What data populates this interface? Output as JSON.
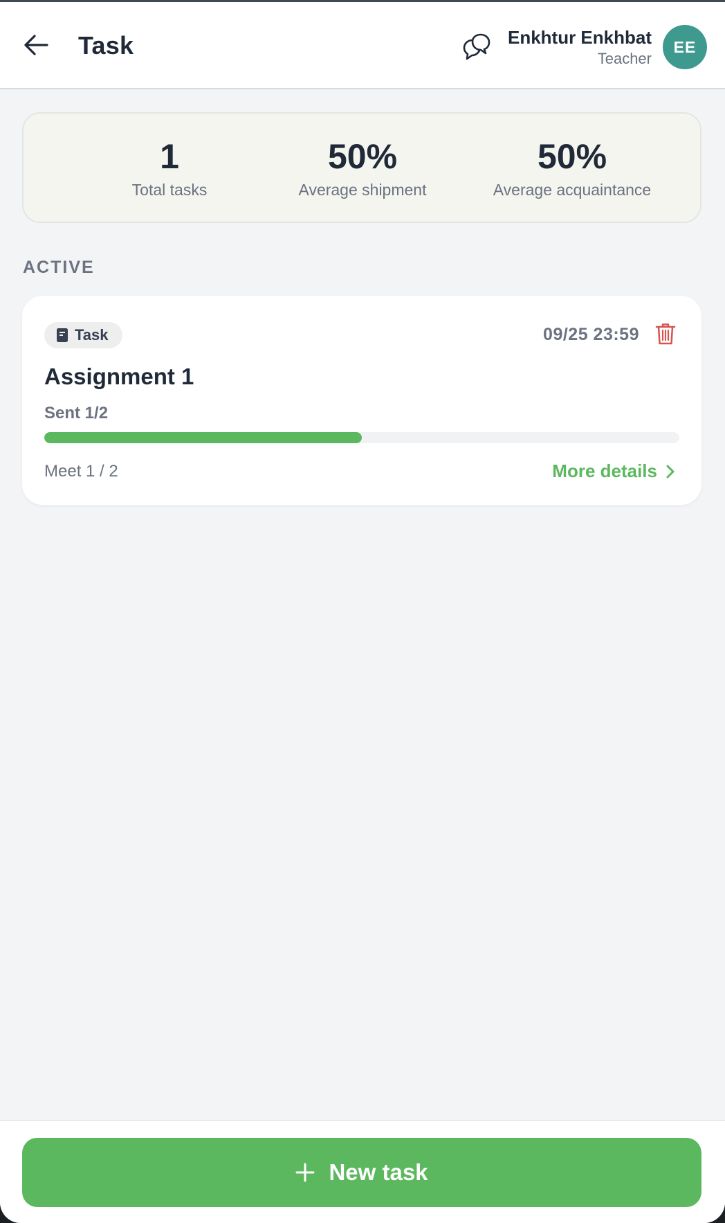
{
  "header": {
    "title": "Task",
    "back_icon": "arrow-left-icon",
    "chat_icon": "chat-bubbles-icon",
    "user": {
      "name": "Enkhtur Enkhbat",
      "role": "Teacher",
      "initials": "EE",
      "avatar_color": "#3e9a8e"
    }
  },
  "stats": [
    {
      "value": "1",
      "label": "Total tasks"
    },
    {
      "value": "50%",
      "label": "Average shipment"
    },
    {
      "value": "50%",
      "label": "Average acquaintance"
    }
  ],
  "section": {
    "label": "ACTIVE"
  },
  "tasks": [
    {
      "type": "Task",
      "type_icon": "document-icon",
      "deadline": "09/25 23:59",
      "title": "Assignment 1",
      "sent_label": "Sent 1/2",
      "progress": 0.5,
      "meet_label": "Meet 1 / 2",
      "details_label": "More details",
      "delete_icon": "trash-icon"
    }
  ],
  "footer": {
    "new_task_label": "New task",
    "icon": "plus-icon"
  },
  "colors": {
    "accent": "#5cb85f",
    "danger": "#d9534f",
    "text": "#1f2937",
    "muted": "#6b7280"
  }
}
